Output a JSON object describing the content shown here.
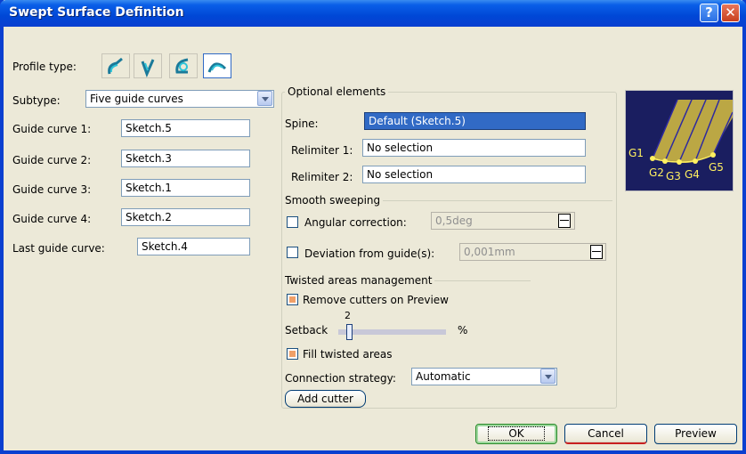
{
  "window": {
    "title": "Swept Surface Definition"
  },
  "titlebar": {
    "help_glyph": "?",
    "close_glyph": "✕"
  },
  "profile": {
    "label": "Profile type:",
    "icons": [
      "explicit-profile-icon",
      "line-profile-icon",
      "circle-profile-icon",
      "conic-profile-icon"
    ],
    "active_index": 3
  },
  "subtype": {
    "label": "Subtype:",
    "value": "Five guide curves"
  },
  "guides": [
    {
      "label": "Guide curve 1:",
      "value": "Sketch.5"
    },
    {
      "label": "Guide curve 2:",
      "value": "Sketch.3"
    },
    {
      "label": "Guide curve 3:",
      "value": "Sketch.1"
    },
    {
      "label": "Guide curve 4:",
      "value": "Sketch.2"
    }
  ],
  "last_guide": {
    "label": "Last guide curve:",
    "value": "Sketch.4"
  },
  "optional": {
    "title": "Optional elements",
    "spine": {
      "label": "Spine:",
      "value": "Default (Sketch.5)"
    },
    "relimiter1": {
      "label": "Relimiter 1:",
      "value": "No selection"
    },
    "relimiter2": {
      "label": "Relimiter 2:",
      "value": "No selection"
    }
  },
  "smooth": {
    "title": "Smooth sweeping",
    "angular": {
      "label": "Angular correction:",
      "value": "0,5deg",
      "checked": false
    },
    "deviation": {
      "label": "Deviation from guide(s):",
      "value": "0,001mm",
      "checked": false
    }
  },
  "twisted": {
    "title": "Twisted areas management",
    "remove_cutters": {
      "label": "Remove cutters on Preview",
      "checked": true
    },
    "setback": {
      "label": "Setback",
      "value": "2",
      "unit": "%",
      "level": 0.02
    },
    "fill": {
      "label": "Fill twisted areas",
      "checked": true
    },
    "connection": {
      "label": "Connection strategy:",
      "value": "Automatic"
    },
    "add_cutter": "Add cutter"
  },
  "preview_image": {
    "labels": [
      "G1",
      "G2",
      "G3",
      "G4",
      "G5"
    ]
  },
  "footer": {
    "ok": "OK",
    "cancel": "Cancel",
    "preview": "Preview"
  },
  "colors": {
    "title_bar": "#0a3fd0",
    "selection": "#316ac5",
    "checkbox_on": "#f0a068",
    "preview_bg": "#1a1e60",
    "surface": "#e8d030"
  }
}
